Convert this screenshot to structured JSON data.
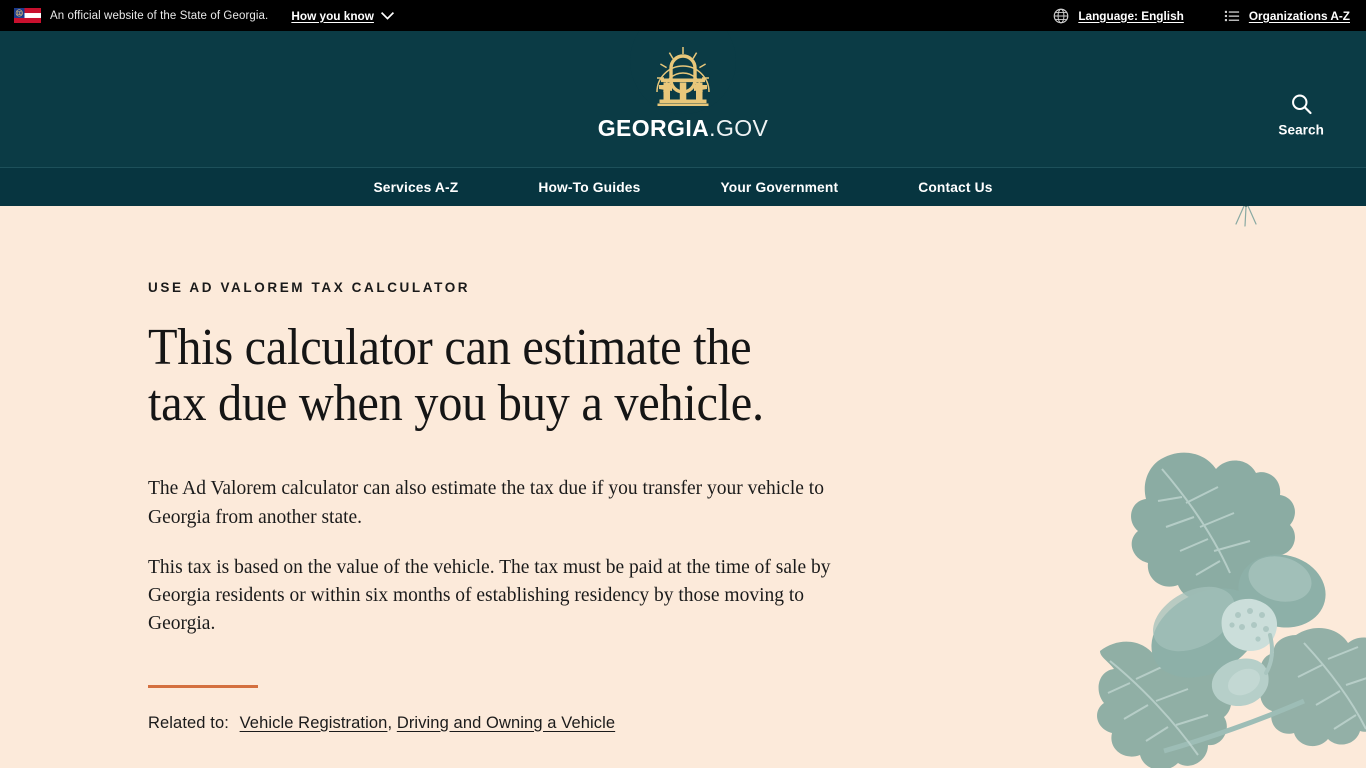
{
  "gov_banner": {
    "flag_icon": "georgia-state-flag-icon",
    "official_text": "An official website of the State of Georgia.",
    "how_you_know_label": "How you know",
    "chevron_icon": "chevron-down-icon",
    "language": {
      "icon": "globe-icon",
      "label": "Language: English"
    },
    "organizations": {
      "icon": "list-icon",
      "label": "Organizations A-Z"
    }
  },
  "masthead": {
    "logo_icon": "georgia-arch-logo-icon",
    "wordmark_strong": "GEORGIA",
    "wordmark_light": ".GOV",
    "search": {
      "icon": "search-icon",
      "label": "Search"
    }
  },
  "primary_nav": {
    "items": [
      {
        "label": "Services A-Z"
      },
      {
        "label": "How-To Guides"
      },
      {
        "label": "Your Government"
      },
      {
        "label": "Contact Us"
      }
    ]
  },
  "hero": {
    "eyebrow": "USE AD VALOREM TAX CALCULATOR",
    "title": "This calculator can estimate the tax due when you buy a vehicle.",
    "paragraphs": [
      "The Ad Valorem calculator can also estimate the tax due if you transfer your vehicle to Georgia from another state.",
      "This tax is based on the value of the vehicle. The tax must be paid at the time of sale by Georgia residents or within six months of establishing residency by those moving to Georgia."
    ],
    "related_label": "Related to:",
    "related_links": [
      {
        "label": "Vehicle Registration"
      },
      {
        "label": "Driving and Owning a Vehicle"
      }
    ],
    "related_separator": ",",
    "decorative": {
      "butterfly_icon": "butterfly-illustration",
      "oak_icon": "oak-leaves-acorns-illustration"
    }
  },
  "colors": {
    "banner_bg": "#000000",
    "masthead_teal": "#0B3B45",
    "nav_teal": "#073540",
    "page_cream": "#FCEADA",
    "accent_orange": "#D4703F",
    "logo_gold": "#E8C77A",
    "botanical_sage": "#7BA39B"
  }
}
